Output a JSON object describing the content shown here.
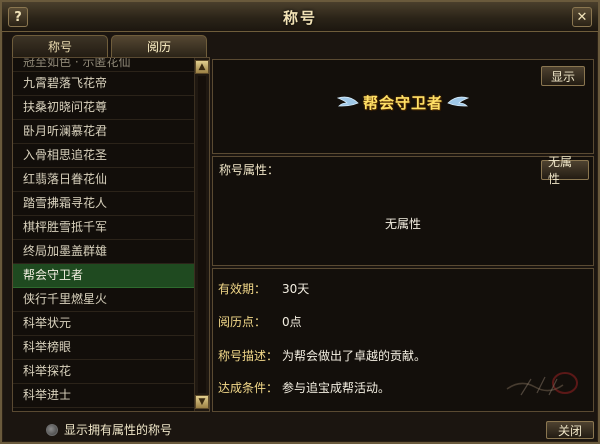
{
  "window": {
    "title": "称号"
  },
  "titlebar": {
    "help_label": "?",
    "close_label": "✕"
  },
  "tabs": [
    {
      "label": "称号",
      "active": false
    },
    {
      "label": "阅历",
      "active": true
    }
  ],
  "title_list": {
    "items": [
      {
        "label": "冠至如色 · 示匿花仙",
        "partial": true
      },
      {
        "label": "九霄碧落飞花帝"
      },
      {
        "label": "扶桑初晓问花尊"
      },
      {
        "label": "卧月听澜慕花君"
      },
      {
        "label": "入骨相思追花圣"
      },
      {
        "label": "红翡落日眷花仙"
      },
      {
        "label": "踏雪拂霜寻花人"
      },
      {
        "label": "棋枰胜雪抵千军"
      },
      {
        "label": "终局加墨盖群雄"
      },
      {
        "label": "帮会守卫者",
        "selected": true
      },
      {
        "label": "侠行千里燃星火"
      },
      {
        "label": "科举状元"
      },
      {
        "label": "科举榜眼"
      },
      {
        "label": "科举探花"
      },
      {
        "label": "科举进士"
      }
    ],
    "scroll_up_icon": "▲",
    "scroll_down_icon": "▼"
  },
  "preview": {
    "show_button": "显示",
    "title_name": "帮会守卫者",
    "wing_color": "#9fc8e8"
  },
  "attributes": {
    "label": "称号属性：",
    "no_attr_button": "无属性",
    "value": "无属性"
  },
  "info": {
    "validity_label": "有效期：",
    "validity_value": "30天",
    "experience_label": "阅历点：",
    "experience_value": "0点",
    "description_label": "称号描述：",
    "description_value": "为帮会做出了卓越的贡献。",
    "condition_label": "达成条件：",
    "condition_value": "参与追宝成帮活动。"
  },
  "footer": {
    "checkbox_label": "显示拥有属性的称号",
    "close_button": "关闭"
  },
  "colors": {
    "accent_gold": "#ffe066",
    "selected_row": "#1f4a20",
    "border": "#6a5a3c"
  }
}
